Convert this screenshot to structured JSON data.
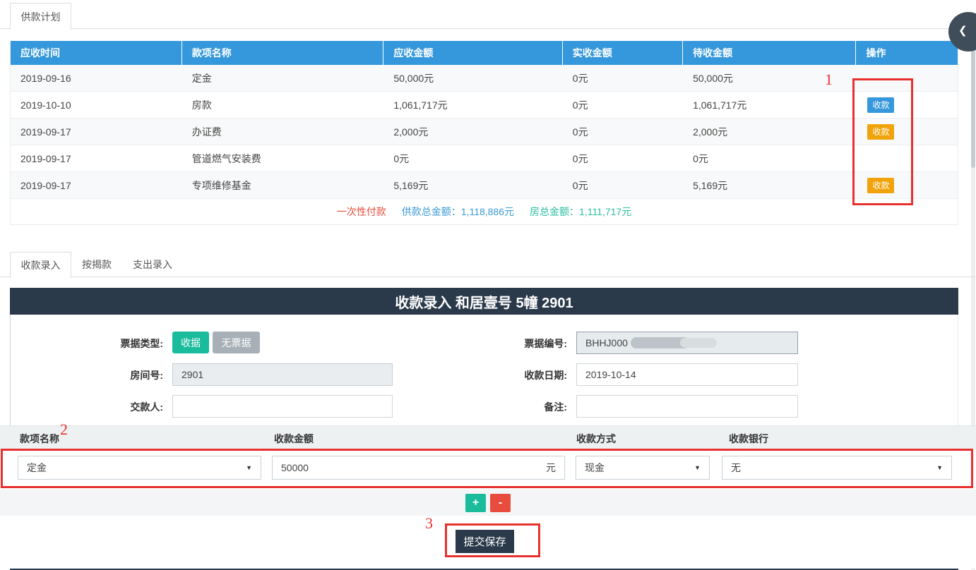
{
  "colors": {
    "header_blue": "#3598dc",
    "action_orange": "#f0a30a",
    "teal": "#1abc9c",
    "danger_red": "#e74c3c",
    "dark_navy": "#2b3a4a",
    "annotation_red": "#e8312e"
  },
  "tabbar1": {
    "plan_tab": "供款计划"
  },
  "plan": {
    "columns": [
      "应收时间",
      "款项名称",
      "应收金额",
      "实收金额",
      "待收金额",
      "操作"
    ],
    "action_label": "收款",
    "rows": [
      {
        "due_date": "2019-09-16",
        "name": "定金",
        "due": "50,000元",
        "received": "0元",
        "pending": "50,000元"
      },
      {
        "due_date": "2019-10-10",
        "name": "房款",
        "due": "1,061,717元",
        "received": "0元",
        "pending": "1,061,717元"
      },
      {
        "due_date": "2019-09-17",
        "name": "办证费",
        "due": "2,000元",
        "received": "0元",
        "pending": "2,000元"
      },
      {
        "due_date": "2019-09-17",
        "name": "管道燃气安装费",
        "due": "0元",
        "received": "0元",
        "pending": "0元"
      },
      {
        "due_date": "2019-09-17",
        "name": "专项维修基金",
        "due": "5,169元",
        "received": "0元",
        "pending": "5,169元"
      }
    ],
    "footer": {
      "payment_type": "一次性付款",
      "plan_total": "供款总金额：1,118,886元",
      "house_total": "房总金额：1,111,717元"
    }
  },
  "tabbar2": {
    "tabs": [
      "收款录入",
      "按揭款",
      "支出录入"
    ],
    "active": "收款录入"
  },
  "entry_panel": {
    "title": "收款录入 和居壹号 5幢 2901",
    "fields": {
      "receipt_type_label": "票据类型:",
      "receipt_btn": "收据",
      "no_receipt_btn": "无票据",
      "receipt_no_label": "票据编号:",
      "receipt_no_value": "BHHJ000",
      "room_label": "房间号:",
      "room_value": "2901",
      "date_label": "收款日期:",
      "date_value": "2019-10-14",
      "payer_label": "交款人:",
      "payer_value": "",
      "remark_label": "备注:",
      "remark_value": ""
    },
    "items_table": {
      "columns": [
        "款项名称",
        "收款金额",
        "收款方式",
        "收款银行"
      ],
      "row": {
        "item_name": "定金",
        "amount": "50000",
        "amount_unit": "元",
        "method": "现金",
        "bank": "无"
      }
    },
    "add_btn": "+",
    "remove_btn": "-",
    "submit_btn": "提交保存"
  },
  "annotations": {
    "step1": "1",
    "step2": "2",
    "step3": "3"
  }
}
